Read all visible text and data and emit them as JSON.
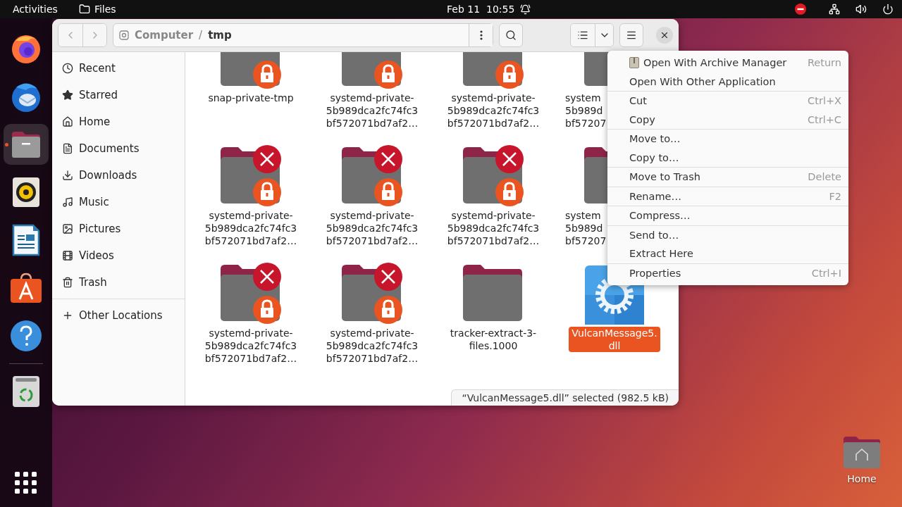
{
  "topbar": {
    "activities": "Activities",
    "app": "Files",
    "date": "Feb 11",
    "time": "10:55"
  },
  "dock": [
    {
      "kind": "firefox",
      "running": false
    },
    {
      "kind": "thunderbird",
      "running": false
    },
    {
      "kind": "files",
      "running": true
    },
    {
      "kind": "rhythmbox",
      "running": false
    },
    {
      "kind": "writer",
      "running": false
    },
    {
      "kind": "appcenter",
      "running": false
    },
    {
      "kind": "help",
      "running": false
    },
    {
      "kind": "trash",
      "running": false
    }
  ],
  "window": {
    "path": [
      {
        "label": "Computer",
        "selected": false
      },
      {
        "label": "tmp",
        "selected": true
      }
    ],
    "path_separator": "/"
  },
  "sidebar": {
    "places": [
      {
        "kind": "recent",
        "label": "Recent"
      },
      {
        "kind": "starred",
        "label": "Starred"
      },
      {
        "kind": "home",
        "label": "Home"
      },
      {
        "kind": "documents",
        "label": "Documents"
      },
      {
        "kind": "downloads",
        "label": "Downloads"
      },
      {
        "kind": "music",
        "label": "Music"
      },
      {
        "kind": "pictures",
        "label": "Pictures"
      },
      {
        "kind": "videos",
        "label": "Videos"
      },
      {
        "kind": "trash",
        "label": "Trash"
      }
    ],
    "other": [
      {
        "kind": "add",
        "label": "Other Locations"
      }
    ]
  },
  "files": [
    {
      "kind": "folder",
      "lines": [
        "snap-private-tmp"
      ],
      "unreadable": false,
      "locked": true,
      "clipped": false,
      "selected": false
    },
    {
      "kind": "folder",
      "lines": [
        "systemd-private-",
        "5b989dca2fc74fc3",
        "bf572071bd7af2…"
      ],
      "unreadable": false,
      "locked": true,
      "clipped": false,
      "selected": false
    },
    {
      "kind": "folder",
      "lines": [
        "systemd-private-",
        "5b989dca2fc74fc3",
        "bf572071bd7af2…"
      ],
      "unreadable": false,
      "locked": true,
      "clipped": false,
      "selected": false
    },
    {
      "kind": "folder",
      "lines": [
        "system",
        "5b989d",
        "bf57207"
      ],
      "unreadable": false,
      "locked": false,
      "clipped": true,
      "selected": false
    },
    {
      "kind": "folder",
      "lines": [
        "systemd-private-",
        "5b989dca2fc74fc3",
        "bf572071bd7af2…"
      ],
      "unreadable": true,
      "locked": true,
      "clipped": false,
      "selected": false
    },
    {
      "kind": "folder",
      "lines": [
        "systemd-private-",
        "5b989dca2fc74fc3",
        "bf572071bd7af2…"
      ],
      "unreadable": true,
      "locked": true,
      "clipped": false,
      "selected": false
    },
    {
      "kind": "folder",
      "lines": [
        "systemd-private-",
        "5b989dca2fc74fc3",
        "bf572071bd7af2…"
      ],
      "unreadable": true,
      "locked": true,
      "clipped": false,
      "selected": false
    },
    {
      "kind": "folder",
      "lines": [
        "system",
        "5b989d",
        "bf57207"
      ],
      "unreadable": false,
      "locked": false,
      "clipped": true,
      "selected": false
    },
    {
      "kind": "folder",
      "lines": [
        "systemd-private-",
        "5b989dca2fc74fc3",
        "bf572071bd7af2…"
      ],
      "unreadable": true,
      "locked": true,
      "clipped": false,
      "selected": false
    },
    {
      "kind": "folder",
      "lines": [
        "systemd-private-",
        "5b989dca2fc74fc3",
        "bf572071bd7af2…"
      ],
      "unreadable": true,
      "locked": true,
      "clipped": false,
      "selected": false
    },
    {
      "kind": "folder",
      "lines": [
        "tracker-extract-3-",
        "files.1000"
      ],
      "unreadable": false,
      "locked": false,
      "clipped": false,
      "selected": false
    },
    {
      "kind": "library",
      "lines": [
        "VulcanMessage5.",
        "dll"
      ],
      "unreadable": false,
      "locked": false,
      "clipped": false,
      "selected": true
    }
  ],
  "status": "“VulcanMessage5.dll” selected (982.5 kB)",
  "context_menu": {
    "sections": [
      [
        {
          "kind": "archive",
          "label": "Open With Archive Manager",
          "shortcut": "Return"
        },
        {
          "kind": "plain",
          "label": "Open With Other Application"
        }
      ],
      [
        {
          "kind": "plain",
          "label": "Cut",
          "shortcut": "Ctrl+X"
        },
        {
          "kind": "plain",
          "label": "Copy",
          "shortcut": "Ctrl+C"
        }
      ],
      [
        {
          "kind": "plain",
          "label": "Move to…"
        },
        {
          "kind": "plain",
          "label": "Copy to…"
        }
      ],
      [
        {
          "kind": "plain",
          "label": "Move to Trash",
          "shortcut": "Delete"
        }
      ],
      [
        {
          "kind": "plain",
          "label": "Rename…",
          "shortcut": "F2"
        }
      ],
      [
        {
          "kind": "plain",
          "label": "Compress…"
        }
      ],
      [
        {
          "kind": "plain",
          "label": "Send to…"
        },
        {
          "kind": "plain",
          "label": "Extract Here"
        }
      ],
      [
        {
          "kind": "plain",
          "label": "Properties",
          "shortcut": "Ctrl+I"
        }
      ]
    ]
  },
  "desktop_icons": [
    {
      "kind": "home",
      "label": "Home"
    }
  ]
}
